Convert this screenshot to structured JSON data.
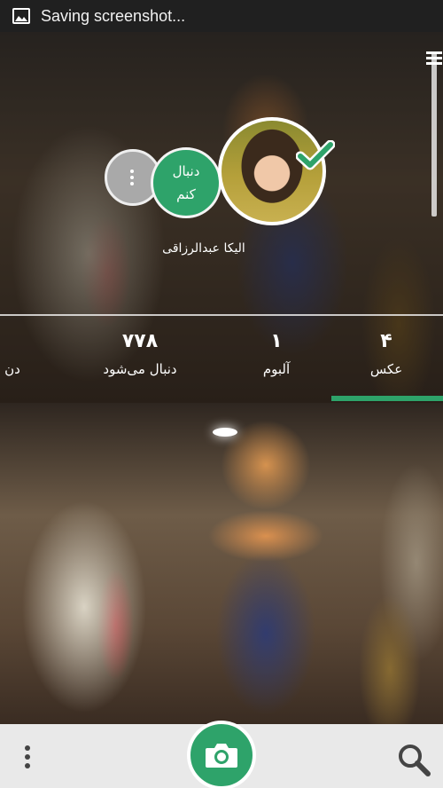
{
  "status_bar": {
    "text": "Saving screenshot..."
  },
  "profile": {
    "name": "الیکا عبدالرزاقی",
    "follow_label": "دنبال\nکنم"
  },
  "stats": {
    "photos": {
      "value": "۴",
      "label": "عکس"
    },
    "albums": {
      "value": "۱",
      "label": "آلبوم"
    },
    "followers": {
      "value": "۷۷۸",
      "label": "دنبال می‌شود"
    },
    "following": {
      "value": "",
      "label": "دن"
    }
  },
  "colors": {
    "accent": "#2ea36a",
    "bottom_bar": "#e9e9e9"
  },
  "icons": {
    "status": "screenshot-icon",
    "verified": "check-icon",
    "more": "vertical-dots-icon",
    "camera": "camera-icon",
    "search": "search-icon",
    "menu": "menu-dots-icon"
  }
}
